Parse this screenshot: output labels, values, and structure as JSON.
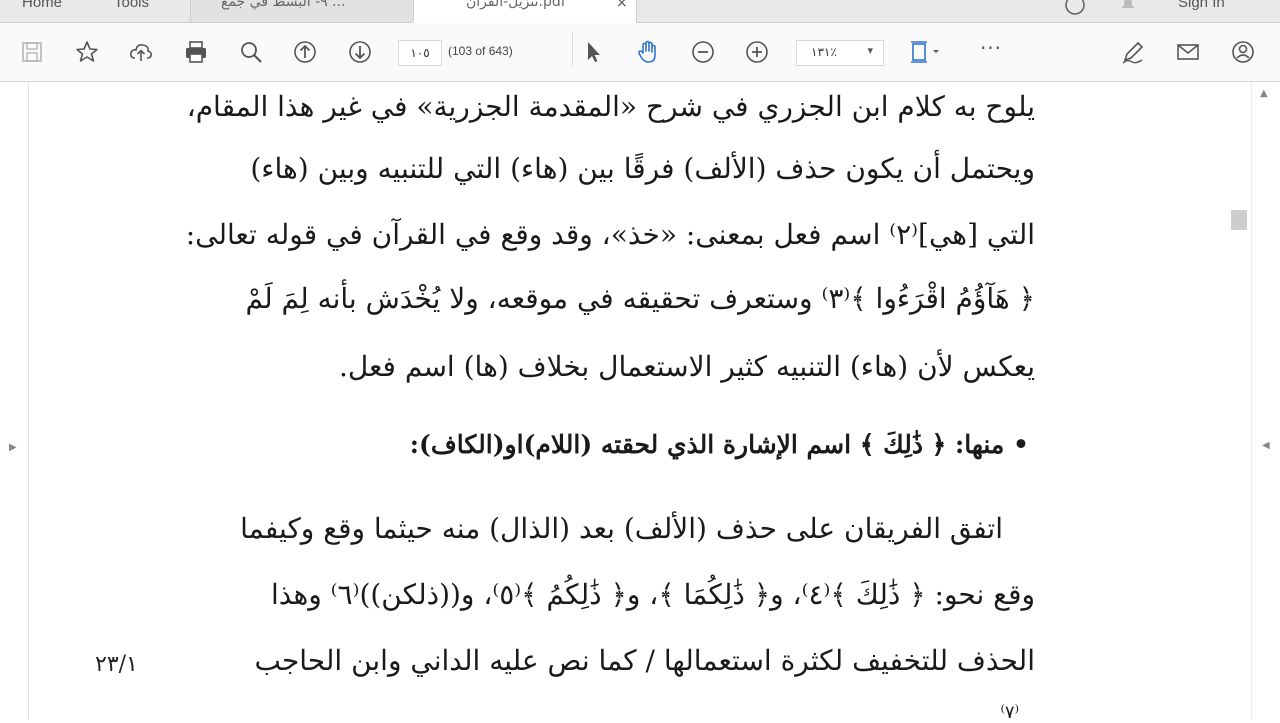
{
  "window": {
    "nav_home": "Home",
    "nav_tools": "Tools",
    "tabs": [
      {
        "title": "٩- البسط في جمع ...",
        "active": false
      },
      {
        "title": "تنزيل-القرآن.pdf",
        "active": true
      }
    ],
    "tab_close_glyph": "×",
    "sign_in": "Sign In"
  },
  "toolbar": {
    "page_number": "١٠٥",
    "page_count": "(103 of 643)",
    "zoom_value": "١٣١٪",
    "zoom_caret": "▾",
    "more": "···"
  },
  "document": {
    "lines": [
      "يلوح به كلام ابن الجزري في شرح «المقدمة الجزرية» في غير هذا المقام،",
      "ويحتمل أن يكون حذف (الألف) فرقًا بين (هاء) التي للتنبيه وبين (هاء)",
      "التي [هي]⁽٢⁾ اسم فعل بمعنى: «خذ»، وقد وقع في القرآن في قوله تعالى:",
      "﴿ هَآؤُمُ اقْرَءُوا ﴾⁽٣⁾ وستعرف تحقيقه في موقعه، ولا يُخْدَش بأنه لِمَ لَمْ",
      "يعكس لأن (هاء) التنبيه كثير الاستعمال بخلاف (ها) اسم فعل.",
      "• منها: ﴿ ذَٰلِكَ ﴾ اسم الإشارة الذي لحقته (اللام)او(الكاف):",
      "اتفق الفريقان على حذف (الألف) بعد (الذال) منه حيثما وقع وكيفما",
      "وقع نحو: ﴿ ذَٰلِكَ ﴾⁽٤⁾، و﴿ ذَٰلِكُمَا ﴾، و﴿ ذَٰلِكُمُ ﴾⁽٥⁾، و((ذلكن))⁽٦⁾ وهذا",
      "الحذف للتخفيف لكثرة استعمالها / كما نص عليه الداني وابن الحاجب",
      "⁽٧⁾"
    ],
    "margin_note": "٢٣/١"
  },
  "icons": [
    "save-icon",
    "bookmark-star-icon",
    "upload-cloud-icon",
    "print-icon",
    "zoom-search-icon",
    "page-up-icon",
    "page-down-icon",
    "select-pointer-icon",
    "hand-tool-icon",
    "zoom-out-icon",
    "zoom-in-icon",
    "fit-page-icon",
    "more-icon",
    "sign-pen-icon",
    "mail-icon",
    "account-icon",
    "help-icon",
    "bell-icon"
  ],
  "colors": {
    "accent": "#2f73c9",
    "toolbar_bg": "#fafafa",
    "tabbar_bg": "#e9e9e9"
  }
}
